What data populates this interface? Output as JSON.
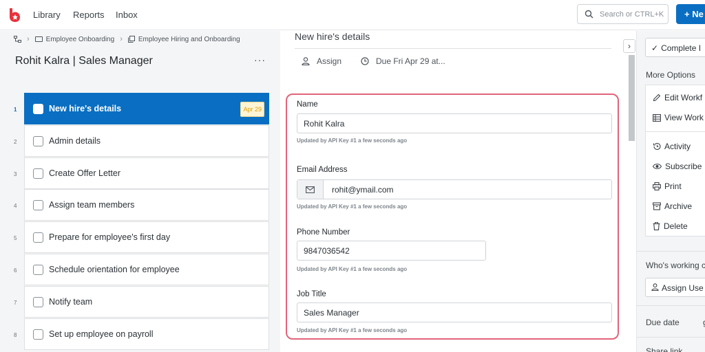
{
  "nav": {
    "links": [
      "Library",
      "Reports",
      "Inbox"
    ],
    "search_placeholder": "Search or CTRL+K",
    "new_button": "+ Ne"
  },
  "breadcrumb": {
    "items": [
      "Employee Onboarding",
      "Employee Hiring and Onboarding"
    ]
  },
  "run": {
    "title": "Rohit Kalra | Sales Manager",
    "more": "···"
  },
  "tasks": [
    {
      "num": "1",
      "label": "New hire's details",
      "due": "Apr 29",
      "active": true
    },
    {
      "num": "2",
      "label": "Admin details"
    },
    {
      "num": "3",
      "label": "Create Offer Letter"
    },
    {
      "num": "4",
      "label": "Assign team members"
    },
    {
      "num": "5",
      "label": "Prepare for employee's first day"
    },
    {
      "num": "6",
      "label": "Schedule orientation for employee"
    },
    {
      "num": "7",
      "label": "Notify team"
    },
    {
      "num": "8",
      "label": "Set up employee on payroll"
    }
  ],
  "task_detail": {
    "title": "New hire's details",
    "assign": "Assign",
    "due": "Due Fri Apr 29 at...",
    "fields": [
      {
        "label": "Name",
        "value": "Rohit Kalra",
        "note": "Updated by API Key #1 a few seconds ago"
      },
      {
        "label": "Email Address",
        "value": "rohit@ymail.com",
        "note": "Updated by API Key #1 a few seconds ago"
      },
      {
        "label": "Phone Number",
        "value": "9847036542",
        "note": "Updated by API Key #1 a few seconds ago"
      },
      {
        "label": "Job Title",
        "value": "Sales Manager",
        "note": "Updated by API Key #1 a few seconds ago"
      }
    ]
  },
  "sidebar": {
    "complete": "Complete I",
    "more_options": "More Options",
    "options": [
      "Edit Workf",
      "View Work",
      "Activity",
      "Subscribe",
      "Print",
      "Archive",
      "Delete"
    ],
    "whos_working": "Who's working c",
    "assign_users": "Assign Use",
    "due_date": "Due date",
    "due_date_value": "g",
    "share_link": "Share link"
  },
  "colors": {
    "primary": "#0a6fc2",
    "highlight_border": "#e2637a",
    "due_badge": "#e09c00"
  }
}
